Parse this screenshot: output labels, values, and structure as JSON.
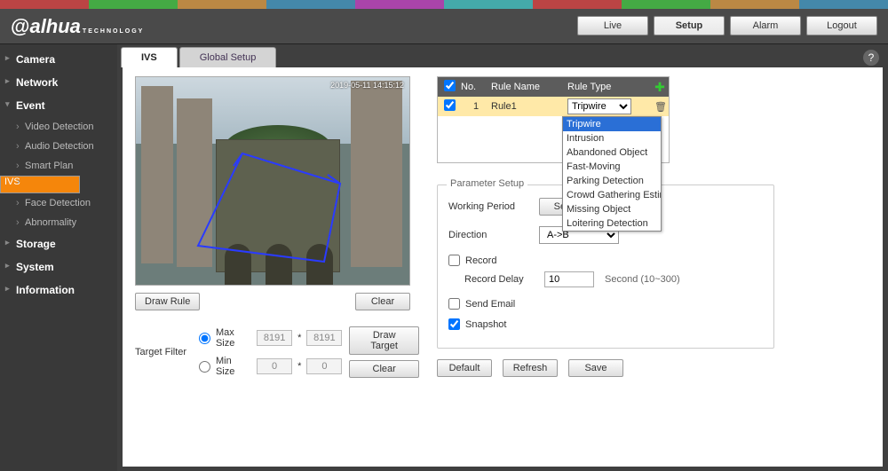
{
  "brand": {
    "name": "alhua",
    "sub": "TECHNOLOGY"
  },
  "nav": {
    "live": "Live",
    "setup": "Setup",
    "alarm": "Alarm",
    "logout": "Logout"
  },
  "sidebar": {
    "camera": "Camera",
    "network": "Network",
    "event": "Event",
    "event_items": {
      "video": "Video Detection",
      "audio": "Audio Detection",
      "smart": "Smart Plan",
      "ivs": "IVS",
      "face": "Face Detection",
      "abn": "Abnormality"
    },
    "storage": "Storage",
    "system": "System",
    "information": "Information"
  },
  "tabs": {
    "ivs": "IVS",
    "global": "Global Setup"
  },
  "preview": {
    "timestamp": "2019-05-11 14:15:12"
  },
  "buttons": {
    "draw_rule": "Draw Rule",
    "clear": "Clear",
    "draw_target": "Draw Target",
    "default": "Default",
    "refresh": "Refresh",
    "save": "Save",
    "setup": "Setup"
  },
  "filter": {
    "label": "Target Filter",
    "max": "Max Size",
    "min": "Min Size",
    "max_w": "8191",
    "max_h": "8191",
    "min_w": "0",
    "min_h": "0",
    "sep": "*"
  },
  "rules": {
    "head_no": "No.",
    "head_name": "Rule Name",
    "head_type": "Rule Type",
    "row": {
      "no": "1",
      "name": "Rule1",
      "type": "Tripwire"
    },
    "options": [
      "Tripwire",
      "Intrusion",
      "Abandoned Object",
      "Fast-Moving",
      "Parking Detection",
      "Crowd Gathering Estimation",
      "Missing Object",
      "Loitering Detection"
    ]
  },
  "param": {
    "legend": "Parameter Setup",
    "working_period": "Working Period",
    "direction": "Direction",
    "direction_val": "A->B",
    "record": "Record",
    "record_delay": "Record Delay",
    "record_delay_val": "10",
    "record_hint": "Second (10~300)",
    "send_email": "Send Email",
    "snapshot": "Snapshot"
  }
}
